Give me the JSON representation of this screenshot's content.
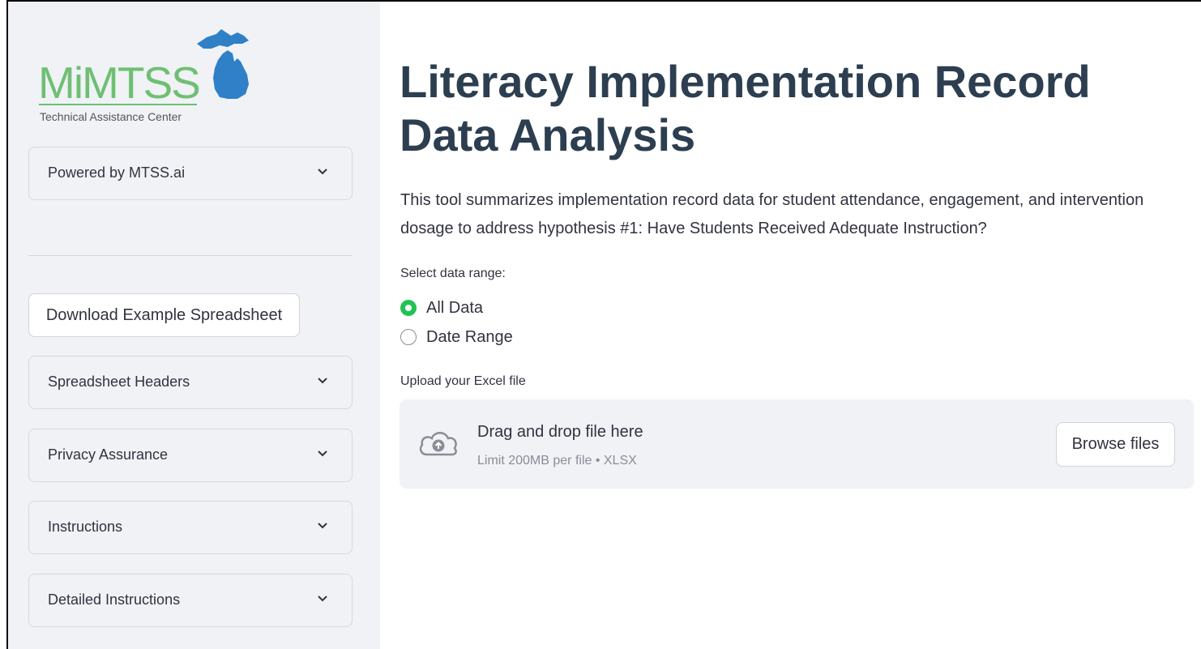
{
  "sidebar": {
    "logo": {
      "name": "MiMTSS",
      "subtitle": "Technical Assistance Center"
    },
    "expanders": [
      {
        "label": "Powered by MTSS.ai"
      },
      {
        "label": "Spreadsheet Headers"
      },
      {
        "label": "Privacy Assurance"
      },
      {
        "label": "Instructions"
      },
      {
        "label": "Detailed Instructions"
      }
    ],
    "download_button": "Download Example Spreadsheet"
  },
  "main": {
    "title": "Literacy Implementation Record Data Analysis",
    "description": "This tool summarizes implementation record data for student attendance, engagement, and intervention dosage to address hypothesis #1: Have Students Received Adequate Instruction?",
    "range_label": "Select data range:",
    "range_options": [
      {
        "label": "All Data",
        "selected": true
      },
      {
        "label": "Date Range",
        "selected": false
      }
    ],
    "upload_label": "Upload your Excel file",
    "upload": {
      "title": "Drag and drop file here",
      "limit": "Limit 200MB per file • XLSX",
      "browse_button": "Browse files"
    }
  },
  "colors": {
    "accent_green": "#21c354",
    "title_color": "#2c3e50",
    "sidebar_bg": "#f0f2f6",
    "logo_green": "#6fbf73",
    "logo_blue": "#2f80c6"
  },
  "icons": {
    "expander": "chevron-down-icon",
    "upload": "cloud-upload-icon",
    "logo_map": "michigan-map-icon"
  }
}
